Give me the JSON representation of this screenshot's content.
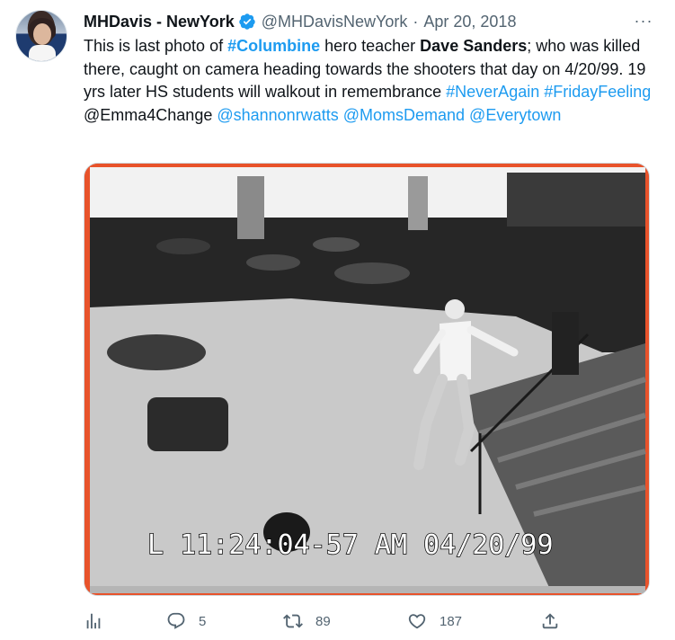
{
  "author": {
    "name": "MHDavis - NewYork",
    "handle": "@MHDavisNewYork",
    "separator": "·",
    "date": "Apr 20, 2018"
  },
  "more_label": "···",
  "tweet": {
    "t1": "This is last photo of ",
    "tag_columbine": "#Columbine",
    "t2": " hero teacher ",
    "bold_name": "Dave Sanders",
    "t3": "; who was killed there, caught on camera heading towards the shooters that day on 4/20/99. 19 yrs later HS students will walkout in remembrance ",
    "tag_neveragain": "#NeverAgain",
    "space1": " ",
    "tag_fridayfeeling": "#FridayFeeling",
    "space2": " ",
    "plain_mention": "@Emma4Change",
    "space3": " ",
    "mention_shannon": "@shannonrwatts",
    "space4": " ",
    "mention_momsdemand": "@MomsDemand",
    "space5": " ",
    "mention_everytown": "@Everytown"
  },
  "media": {
    "timestamp_overlay": "L 11:24:04-57 AM  04/20/99"
  },
  "actions": {
    "replies": "5",
    "retweets": "89",
    "likes": "187"
  },
  "colors": {
    "accent": "#1d9bf0",
    "secondary_text": "#536471",
    "verified_badge": "#1d9bf0"
  },
  "icons": [
    "verified-badge-icon",
    "more-icon",
    "analytics-icon",
    "reply-icon",
    "retweet-icon",
    "like-icon",
    "share-icon"
  ]
}
